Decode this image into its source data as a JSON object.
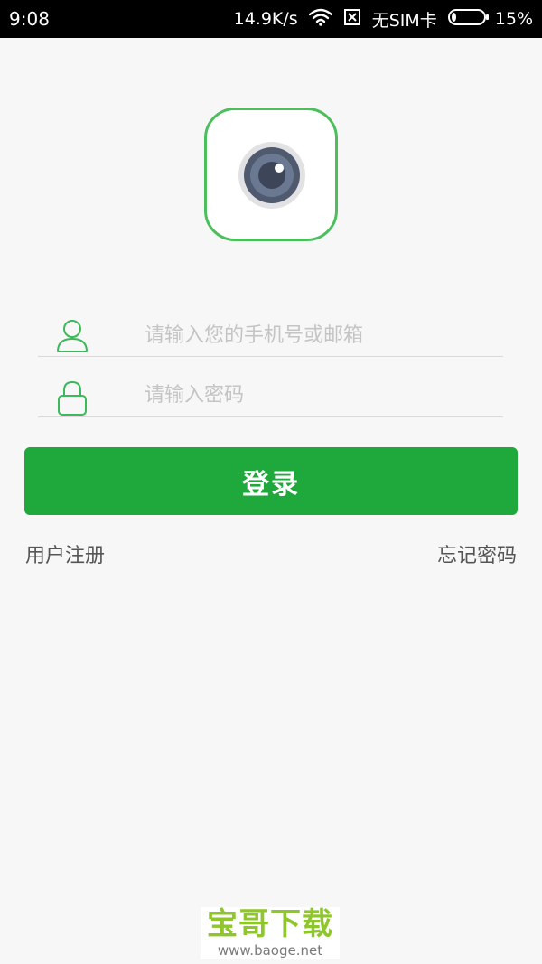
{
  "status_bar": {
    "time": "9:08",
    "network_speed": "14.9K/s",
    "sim_status": "无SIM卡",
    "battery_percent": "15%",
    "battery_level": 0.15,
    "icons": [
      "wifi-icon",
      "no-sim-icon",
      "battery-icon"
    ]
  },
  "logo": {
    "icon": "camera-lens-icon",
    "border_color": "#4cbf5c"
  },
  "form": {
    "phone_placeholder": "请输入您的手机号或邮箱",
    "phone_value": "",
    "phone_icon": "user-icon",
    "password_placeholder": "请输入密码",
    "password_value": "",
    "password_icon": "lock-icon"
  },
  "login_button": {
    "label": "登录",
    "color": "#1fa83b"
  },
  "links": {
    "register": "用户注册",
    "forgot_password": "忘记密码"
  },
  "watermark": {
    "title": "宝哥下载",
    "url": "www.baoge.net",
    "color": "#8fc62e"
  }
}
